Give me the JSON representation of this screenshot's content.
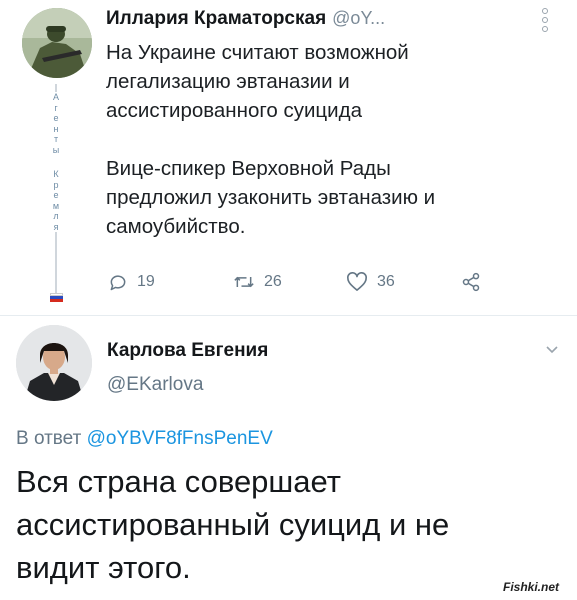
{
  "tweet1": {
    "author_name": "Иллария Краматорская",
    "author_handle": "@oY...",
    "text_lines": [
      "На Украине считают возможной",
      "легализацию эвтаназии и",
      "ассистированного суицида",
      "",
      "Вице-спикер Верховной Рады",
      "предложил узаконить эвтаназию и",
      "самоубийство."
    ],
    "side_letters": [
      "А",
      "г",
      "е",
      "н",
      "т",
      "ы",
      "",
      "К",
      "р",
      "е",
      "м",
      "л",
      "я"
    ],
    "reply_count": "19",
    "retweet_count": "26",
    "like_count": "36",
    "icons": {
      "reply": "reply-icon",
      "retweet": "retweet-icon",
      "like": "heart-icon",
      "share": "share-icon",
      "menu": "more-options-icon"
    }
  },
  "tweet2": {
    "author_name": "Карлова Евгения",
    "author_handle": "@EKarlova",
    "reply_prefix": "В ответ",
    "reply_to": "@oYBVF8fFnsPenEV",
    "text_lines": [
      "Вся страна совершает",
      "ассистированный суицид и не",
      "видит этого."
    ]
  },
  "watermark": "Fishki.net",
  "colors": {
    "link": "#1b95e0",
    "muted": "#657786",
    "text": "#14171a",
    "divider": "#e6ecf0"
  }
}
